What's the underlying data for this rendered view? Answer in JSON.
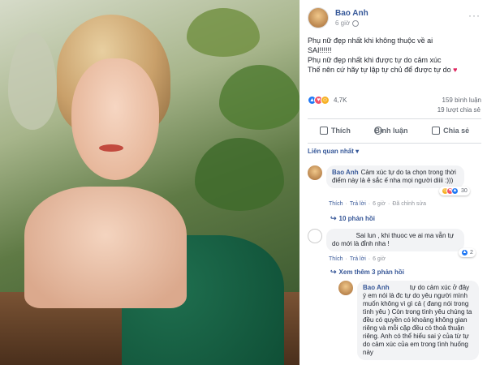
{
  "post": {
    "author": "Bao Anh",
    "time": "6 giờ",
    "lines": [
      "Phụ nữ đẹp nhất khi không thuộc về ai",
      "SAI!!!!!!",
      "Phụ nữ đẹp nhất khi được tự do cảm xúc",
      "Thế nên cứ hãy tự lập tự chủ để được tự do"
    ],
    "reaction_count": "4,7K",
    "comments_count": "159 bình luận",
    "shares_count": "19 lượt chia sẻ"
  },
  "actions": {
    "like": "Thích",
    "comment": "Bình luận",
    "share": "Chia sẻ"
  },
  "sort_label": "Liên quan nhất",
  "comments": [
    {
      "author": "Bao Anh",
      "text": "Cảm xúc tự do ta chọn trong thời điểm này là ê sắc ế nha mọi người diiii :)))",
      "like": "Thích",
      "reply": "Trả lời",
      "time": "6 giờ",
      "edited": "Đã chỉnh sửa",
      "reactions": "30",
      "replies": "10 phản hồi"
    },
    {
      "author": "",
      "text": "Sai lun , khi thuoc ve ai ma vẫn tự do mới là đỉnh nha !",
      "like": "Thích",
      "reply": "Trả lời",
      "time": "6 giờ",
      "reactions": "2",
      "replies": "Xem thêm 3 phản hồi"
    },
    {
      "author": "Bao Anh",
      "text": "tự do cảm xúc ở đây ý em nói là đc tự do yêu người mình muốn không vì gì cả ( đang nói trong tình yêu ) Còn trong tình yêu chúng ta đều có quyền có khoảng không gian riêng và mỗi cặp đều có thoả thuận riêng. Anh có thể hiểu sai ý của từ tự do cảm xúc của em trong tình huống này"
    }
  ]
}
